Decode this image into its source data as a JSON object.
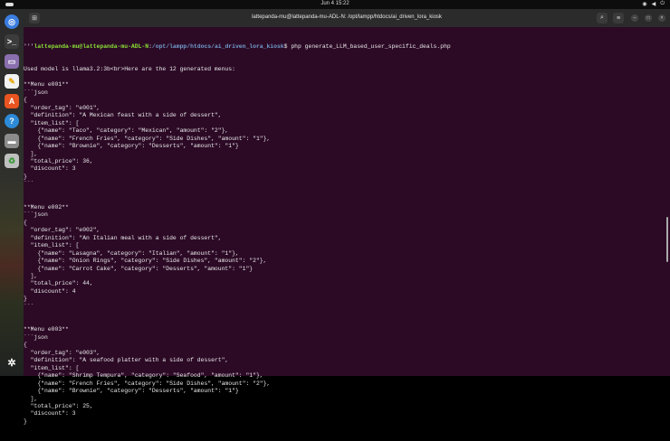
{
  "topbar": {
    "clock": "Jun 4  15:22",
    "tray": [
      "wifi-icon",
      "volume-icon",
      "power-icon"
    ]
  },
  "dock": [
    "chromium",
    "terminal",
    "files",
    "text-editor",
    "app-center",
    "help",
    "disks",
    "trash"
  ],
  "window": {
    "title": "lattepanda-mu@lattepanda-mu-ADL-N: /opt/lampp/htdocs/ai_driven_lora_kiosk"
  },
  "prompt": {
    "pre": "'''",
    "user": "lattepanda-mu@lattepanda-mu-ADL-N",
    "sep": ":",
    "path": "/opt/lampp/htdocs/ai_driven_lora_kiosk",
    "cmd": "$ php generate_LLM_based_user_specific_deals.php"
  },
  "lines": [
    "Used model is llama3.2:3b<br>Here are the 12 generated menus:",
    "",
    "**Menu e001**",
    "```json",
    "{",
    "  \"order_tag\": \"e001\",",
    "  \"definition\": \"A Mexican feast with a side of dessert\",",
    "  \"item_list\": [",
    "    {\"name\": \"Taco\", \"category\": \"Mexican\", \"amount\": \"2\"},",
    "    {\"name\": \"French Fries\", \"category\": \"Side Dishes\", \"amount\": \"1\"},",
    "    {\"name\": \"Brownie\", \"category\": \"Desserts\", \"amount\": \"1\"}",
    "  ],",
    "  \"total_price\": 36,",
    "  \"discount\": 3",
    "}",
    "```",
    "",
    "",
    "**Menu e002**",
    "```json",
    "{",
    "  \"order_tag\": \"e002\",",
    "  \"definition\": \"An Italian meal with a side of dessert\",",
    "  \"item_list\": [",
    "    {\"name\": \"Lasagna\", \"category\": \"Italian\", \"amount\": \"1\"},",
    "    {\"name\": \"Onion Rings\", \"category\": \"Side Dishes\", \"amount\": \"2\"},",
    "    {\"name\": \"Carrot Cake\", \"category\": \"Desserts\", \"amount\": \"1\"}",
    "  ],",
    "  \"total_price\": 44,",
    "  \"discount\": 4",
    "}",
    "```",
    "",
    "",
    "**Menu e003**",
    "```json",
    "{",
    "  \"order_tag\": \"e003\",",
    "  \"definition\": \"A seafood platter with a side of dessert\",",
    "  \"item_list\": [",
    "    {\"name\": \"Shrimp Tempura\", \"category\": \"Seafood\", \"amount\": \"1\"},",
    "    {\"name\": \"French Fries\", \"category\": \"Side Dishes\", \"amount\": \"2\"},",
    "    {\"name\": \"Brownie\", \"category\": \"Desserts\", \"amount\": \"1\"}",
    "  ],",
    "  \"total_price\": 25,",
    "  \"discount\": 3",
    "}"
  ]
}
